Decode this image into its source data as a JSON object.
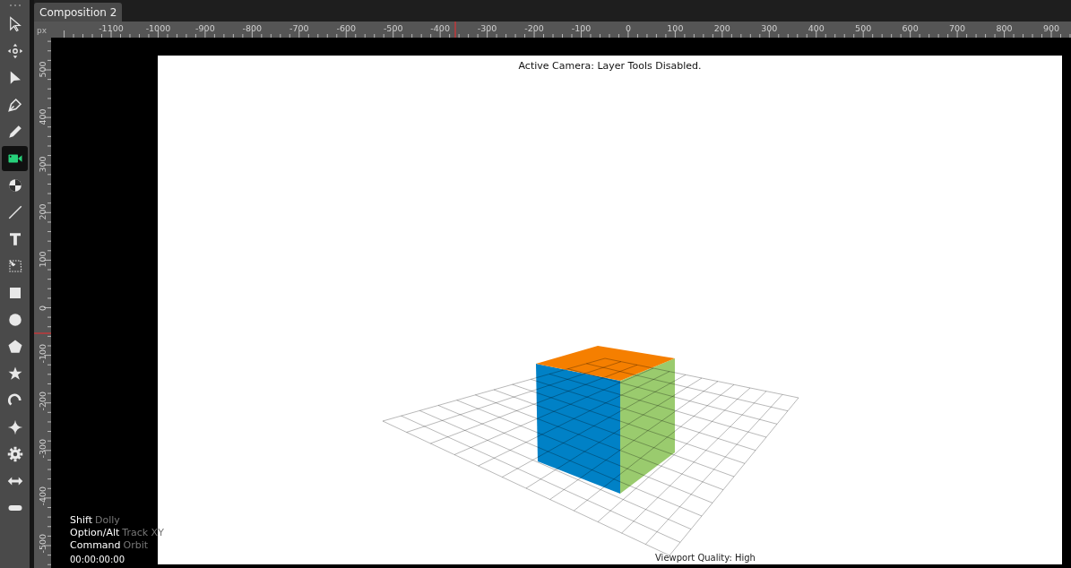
{
  "tab": {
    "label": "Composition 2",
    "selected": true
  },
  "tools": [
    {
      "kind": "select",
      "selected": false
    },
    {
      "kind": "move",
      "selected": false
    },
    {
      "kind": "direct",
      "selected": false
    },
    {
      "kind": "pen",
      "selected": false
    },
    {
      "kind": "pencil",
      "selected": false
    },
    {
      "kind": "camera",
      "selected": true
    },
    {
      "kind": "anchor",
      "selected": false
    },
    {
      "kind": "line",
      "selected": false
    },
    {
      "kind": "text",
      "selected": false
    },
    {
      "kind": "transform",
      "selected": false
    },
    {
      "kind": "rect",
      "selected": false
    },
    {
      "kind": "ellipse",
      "selected": false
    },
    {
      "kind": "polygon",
      "selected": false
    },
    {
      "kind": "star",
      "selected": false
    },
    {
      "kind": "arc",
      "selected": false
    },
    {
      "kind": "sparkle",
      "selected": false
    },
    {
      "kind": "gear",
      "selected": false
    },
    {
      "kind": "width",
      "selected": false
    },
    {
      "kind": "pill",
      "selected": false
    }
  ],
  "ruler": {
    "unit": "px",
    "x_labels": [
      "-1100",
      "-1000",
      "-900",
      "-800",
      "-700",
      "-600",
      "-500",
      "-400",
      "-300",
      "-200",
      "-100",
      "0",
      "100",
      "200",
      "300",
      "400",
      "500",
      "600",
      "700",
      "800",
      "900"
    ],
    "y_labels": [
      "500",
      "400",
      "300",
      "200",
      "100",
      "0",
      "-100",
      "-200",
      "-300",
      "-400",
      "-500"
    ]
  },
  "viewport": {
    "status": "Active Camera: Layer Tools Disabled.",
    "quality": "Viewport Quality: High",
    "timecode": "00:00:00:00",
    "hints": [
      {
        "key": "Shift",
        "action": "Dolly"
      },
      {
        "key": "Option/Alt",
        "action": "Track XY"
      },
      {
        "key": "Command",
        "action": "Orbit"
      }
    ]
  }
}
